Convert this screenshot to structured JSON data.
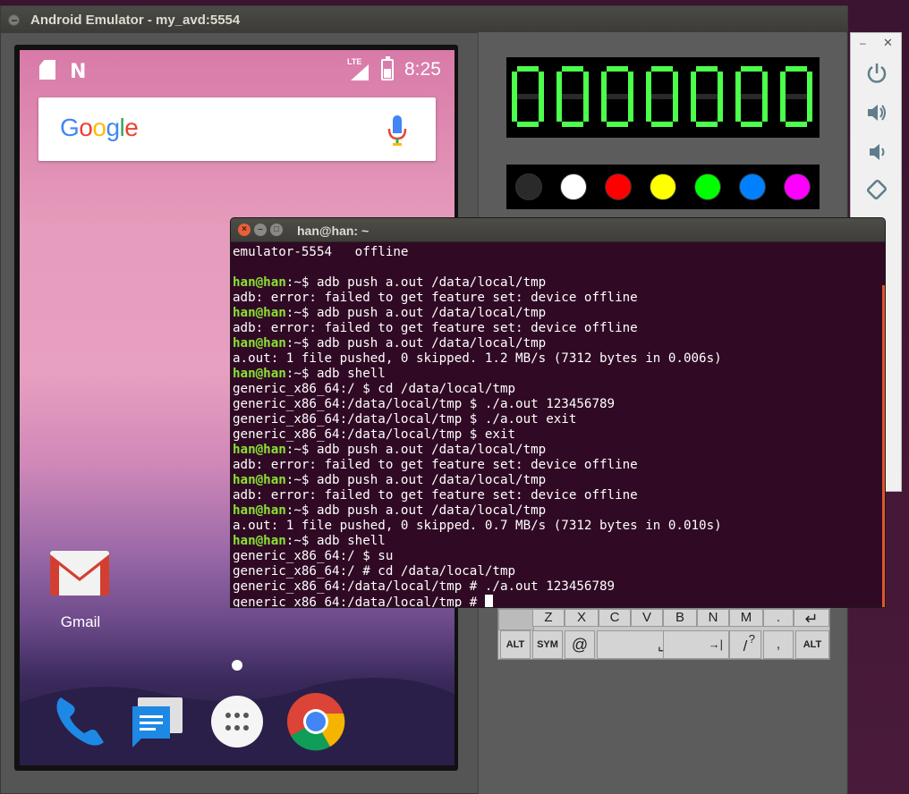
{
  "emulator": {
    "title": "Android Emulator - my_avd:5554"
  },
  "android": {
    "network_label": "LTE",
    "clock": "8:25",
    "search_logo": [
      "G",
      "o",
      "o",
      "g",
      "l",
      "e"
    ],
    "app_label": "Gmail",
    "dock": [
      "phone-icon",
      "messages-icon",
      "app-drawer-icon",
      "chrome-icon"
    ]
  },
  "panel": {
    "lcd_digits": "0000000",
    "led_colors": [
      "#2a2a2a",
      "#ffffff",
      "#ff0000",
      "#ffff00",
      "#00ff00",
      "#0080ff",
      "#ff00ff"
    ],
    "keyboard": {
      "row1": [
        "Z",
        "X",
        "C",
        "V",
        "B",
        "N",
        "M",
        "."
      ],
      "alt_left": "ALT",
      "sym": "SYM",
      "at": "@",
      "space": "␣",
      "slash": "/",
      "question": "?",
      "comma": ",",
      "alt_right": "ALT"
    }
  },
  "terminal": {
    "title": "han@han: ~",
    "lines": [
      {
        "prompt": "",
        "text": "emulator-5554   offline"
      },
      {
        "prompt": "",
        "text": ""
      },
      {
        "prompt": "han@han",
        "text": ":~$ adb push a.out /data/local/tmp"
      },
      {
        "prompt": "",
        "text": "adb: error: failed to get feature set: device offline"
      },
      {
        "prompt": "han@han",
        "text": ":~$ adb push a.out /data/local/tmp"
      },
      {
        "prompt": "",
        "text": "adb: error: failed to get feature set: device offline"
      },
      {
        "prompt": "han@han",
        "text": ":~$ adb push a.out /data/local/tmp"
      },
      {
        "prompt": "",
        "text": "a.out: 1 file pushed, 0 skipped. 1.2 MB/s (7312 bytes in 0.006s)"
      },
      {
        "prompt": "han@han",
        "text": ":~$ adb shell"
      },
      {
        "prompt": "",
        "text": "generic_x86_64:/ $ cd /data/local/tmp"
      },
      {
        "prompt": "",
        "text": "generic_x86_64:/data/local/tmp $ ./a.out 123456789"
      },
      {
        "prompt": "",
        "text": "generic_x86_64:/data/local/tmp $ ./a.out exit"
      },
      {
        "prompt": "",
        "text": "generic_x86_64:/data/local/tmp $ exit"
      },
      {
        "prompt": "han@han",
        "text": ":~$ adb push a.out /data/local/tmp"
      },
      {
        "prompt": "",
        "text": "adb: error: failed to get feature set: device offline"
      },
      {
        "prompt": "han@han",
        "text": ":~$ adb push a.out /data/local/tmp"
      },
      {
        "prompt": "",
        "text": "adb: error: failed to get feature set: device offline"
      },
      {
        "prompt": "han@han",
        "text": ":~$ adb push a.out /data/local/tmp"
      },
      {
        "prompt": "",
        "text": "a.out: 1 file pushed, 0 skipped. 0.7 MB/s (7312 bytes in 0.010s)"
      },
      {
        "prompt": "han@han",
        "text": ":~$ adb shell"
      },
      {
        "prompt": "",
        "text": "generic_x86_64:/ $ su"
      },
      {
        "prompt": "",
        "text": "generic_x86_64:/ # cd /data/local/tmp"
      },
      {
        "prompt": "",
        "text": "generic_x86_64:/data/local/tmp # ./a.out 123456789"
      },
      {
        "prompt": "",
        "text": "generic_x86_64:/data/local/tmp # "
      }
    ]
  }
}
